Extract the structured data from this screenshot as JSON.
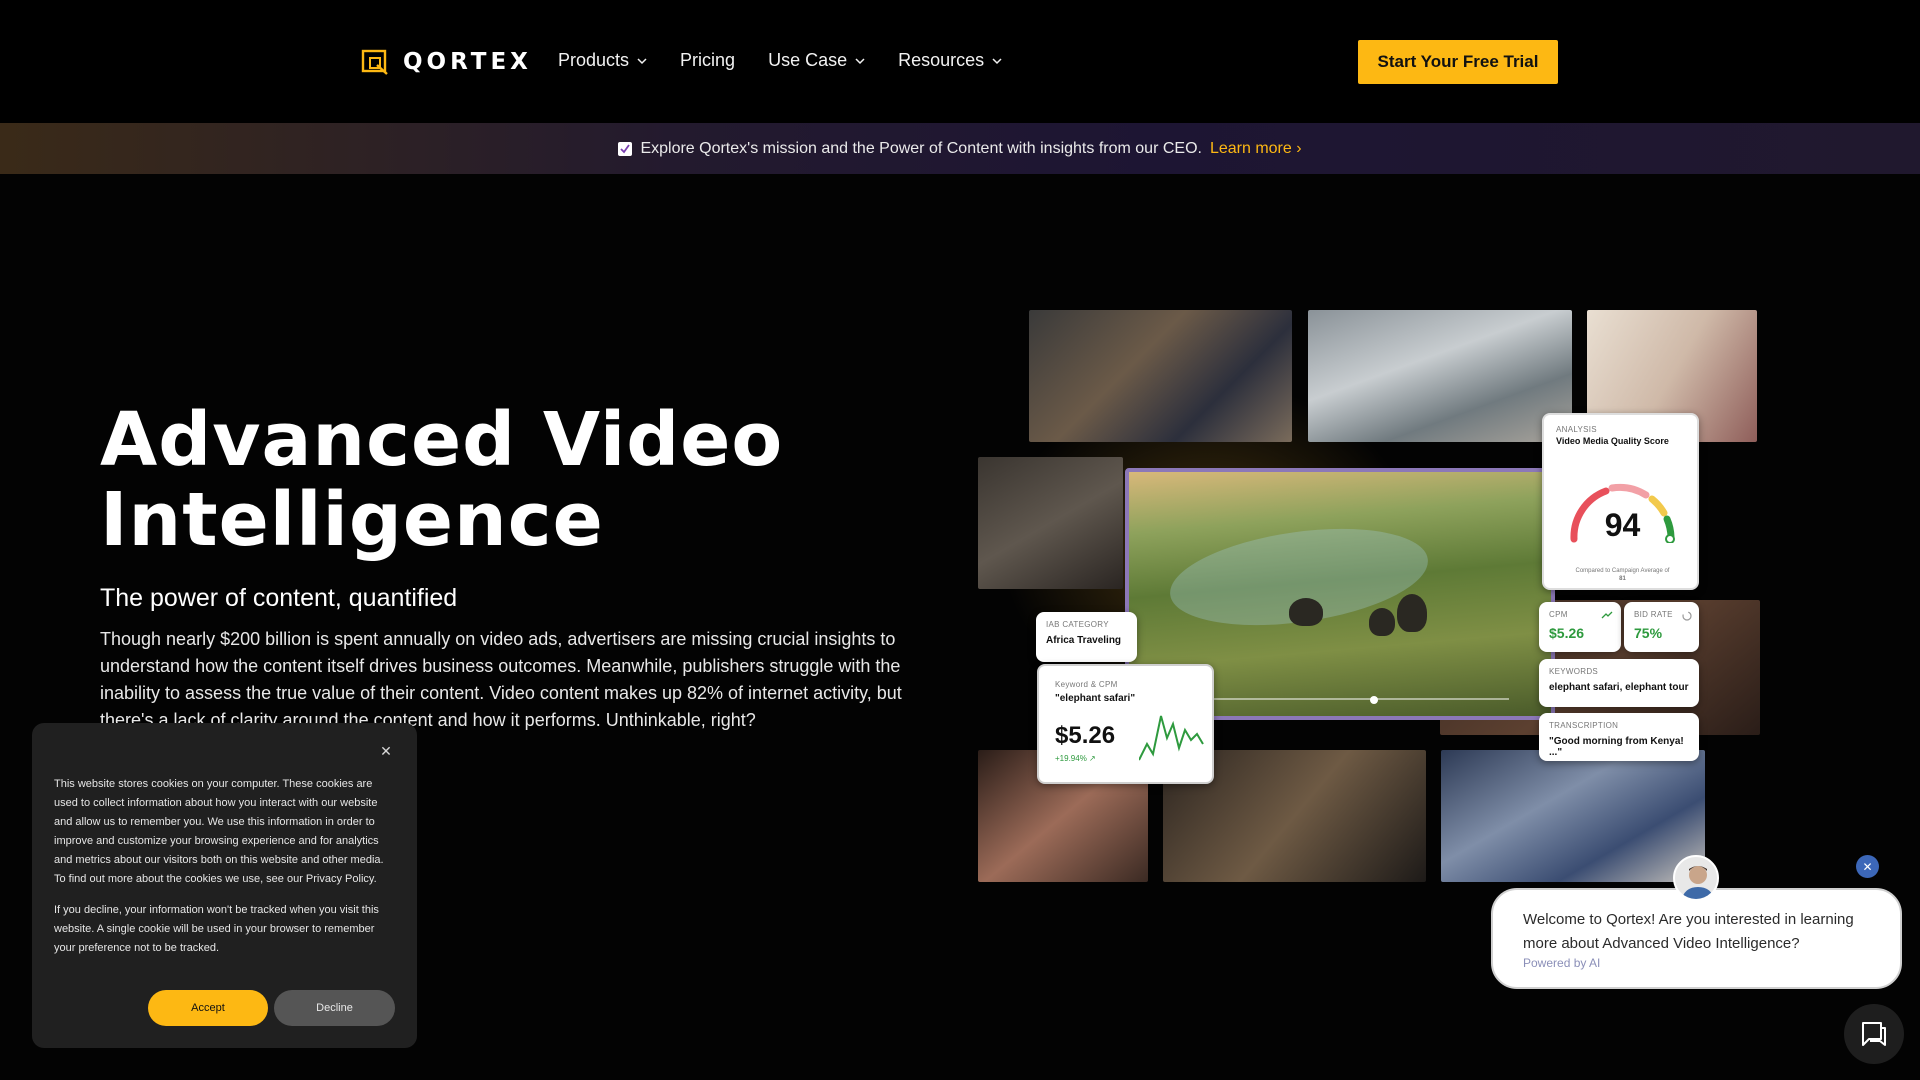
{
  "nav": {
    "logo_text": "QORTEX",
    "links": [
      {
        "label": "Products",
        "has_dropdown": true
      },
      {
        "label": "Pricing",
        "has_dropdown": false
      },
      {
        "label": "Use Case",
        "has_dropdown": true
      },
      {
        "label": "Resources",
        "has_dropdown": true
      }
    ],
    "cta_label": "Start Your Free Trial"
  },
  "announcement": {
    "icon": "checkbox-icon",
    "text": "Explore Qortex's mission and the Power of Content with insights from our CEO.",
    "link_label": "Learn more ›"
  },
  "hero": {
    "title_line1": "Advanced Video",
    "title_line2": "Intelligence",
    "subtitle": "The power of content, quantified",
    "body": "Though nearly $200 billion is spent annually on video ads, advertisers are missing crucial insights to understand how the content itself drives business outcomes. Meanwhile, publishers struggle with the inability to assess the true value of their content. Video content makes up 82% of internet activity, but there's a lack of clarity around the content and how it performs. Unthinkable, right?"
  },
  "collage": {
    "quality_card": {
      "label": "Analysis",
      "title": "Video Media Quality Score",
      "score": "94",
      "note": "Compared to Campaign Average of",
      "note_value": "81"
    },
    "cpm_card": {
      "label": "CPM",
      "value": "$5.26"
    },
    "bid_card": {
      "label": "BID RATE",
      "value": "75%"
    },
    "keywords_card": {
      "label": "KEYWORDS",
      "value": "elephant safari, elephant tour"
    },
    "transcription_card": {
      "label": "TRANSCRIPTION",
      "value": "\"Good morning from Kenya! ...\""
    },
    "iab_card": {
      "label": "IAB CATEGORY",
      "value": "Africa Traveling"
    },
    "keyword_cpm_card": {
      "label": "Keyword & CPM",
      "keyword": "\"elephant safari\"",
      "price": "$5.26",
      "delta": "+19.94% ↗"
    }
  },
  "cookie": {
    "text1": "This website stores cookies on your computer. These cookies are used to collect information about how you interact with our website and allow us to remember you. We use this information in order to improve and customize your browsing experience and for analytics and metrics about our visitors both on this website and other media. To find out more about the cookies we use, see our Privacy Policy.",
    "text2": "If you decline, your information won't be tracked when you visit this website. A single cookie will be used in your browser to remember your preference not to be tracked.",
    "accept_label": "Accept",
    "decline_label": "Decline",
    "close_icon": "close-icon"
  },
  "chat": {
    "message": "Welcome to Qortex! Are you interested in learning more about Advanced Video Intelligence?",
    "powered": "Powered by AI",
    "close_icon": "close-icon",
    "launcher_icon": "chat-icon"
  },
  "colors": {
    "accent": "#fdb813",
    "background": "#030303",
    "positive": "#2e9a3e"
  }
}
